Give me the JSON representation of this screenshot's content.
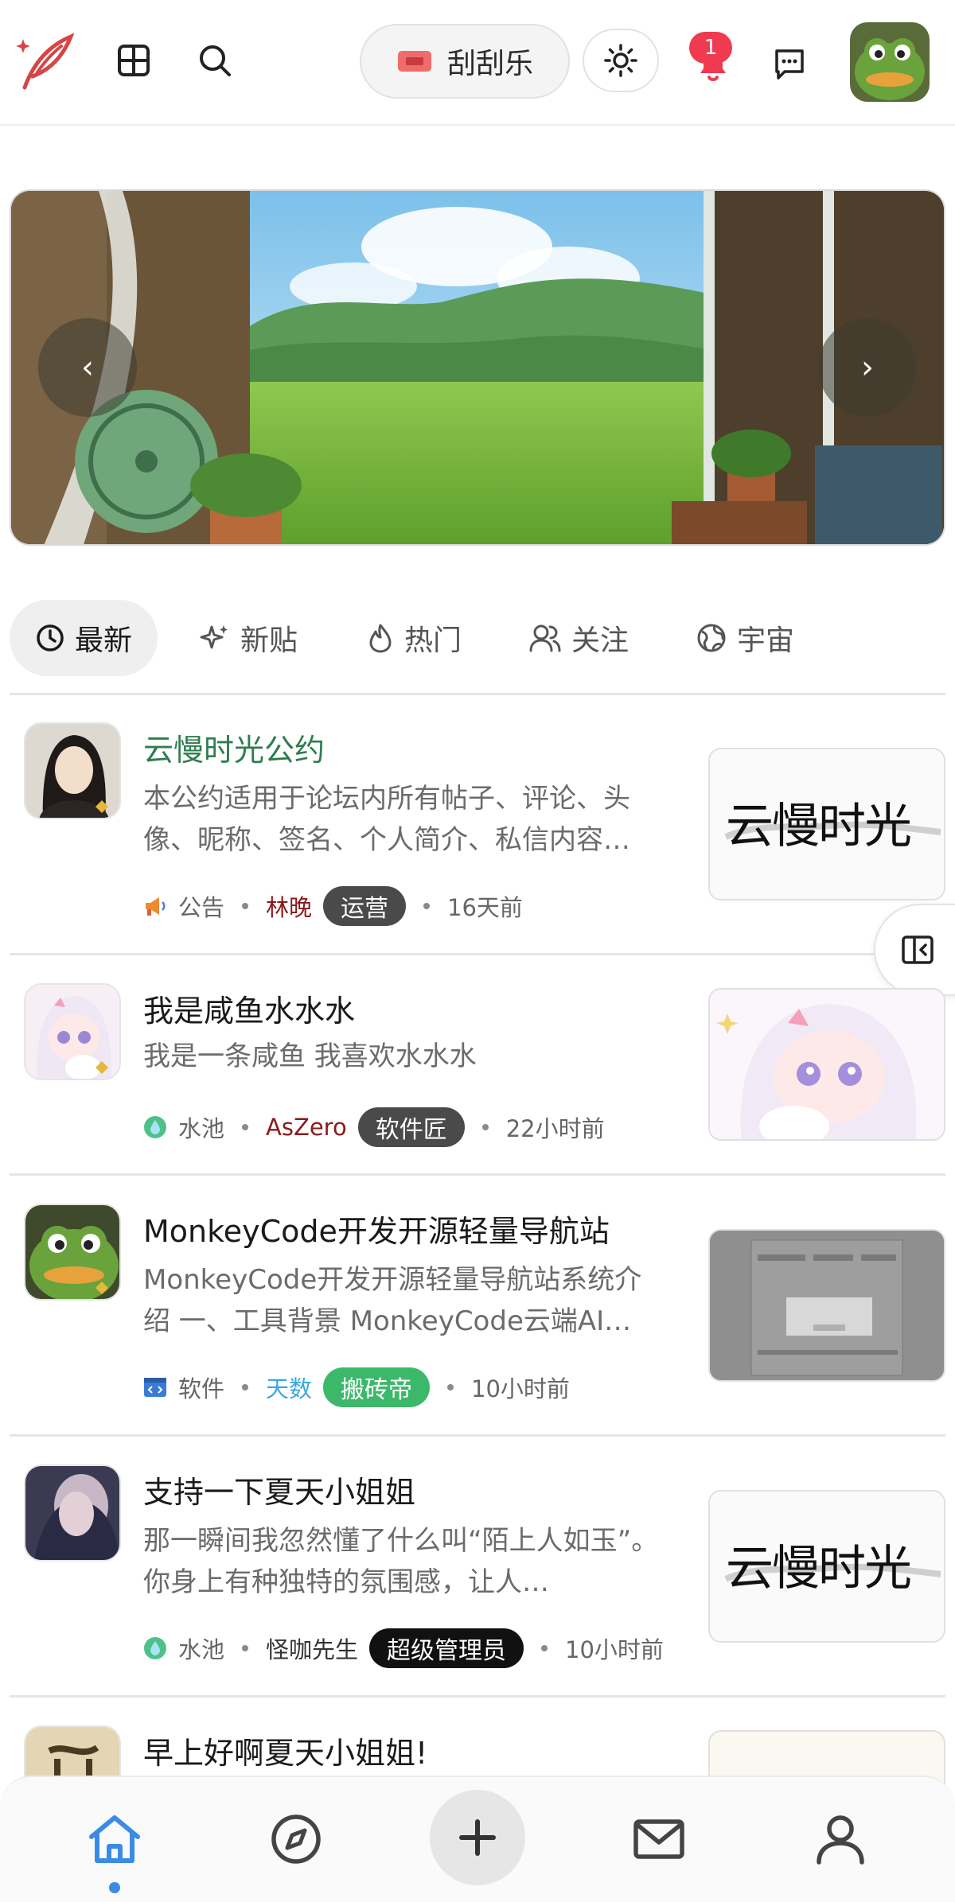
{
  "header": {
    "lottery_label": "刮刮乐",
    "notification_count": "1"
  },
  "tabs": [
    {
      "label": "最新",
      "icon": "clock-icon",
      "active": true
    },
    {
      "label": "新贴",
      "icon": "sparkle-icon",
      "active": false
    },
    {
      "label": "热门",
      "icon": "flame-icon",
      "active": false
    },
    {
      "label": "关注",
      "icon": "users-icon",
      "active": false
    },
    {
      "label": "宇宙",
      "icon": "globe-icon",
      "active": false
    }
  ],
  "posts": [
    {
      "title": "云慢时光公约",
      "excerpt": "本公约适用于论坛内所有帖子、评论、头像、昵称、签名、个人简介、私信内容…",
      "category": "公告",
      "category_icon": "megaphone-icon",
      "author": "林晚",
      "author_color": "#8b1a1a",
      "role": "运营",
      "role_color": "#4a4a4a",
      "time": "16天前",
      "thumb_text": "云慢时光",
      "pinned": true
    },
    {
      "title": "我是咸鱼水水水",
      "excerpt": "我是一条咸鱼 我喜欢水水水",
      "category": "水池",
      "category_icon": "water-icon",
      "author": "AsZero",
      "author_color": "#8b1a1a",
      "role": "软件匠",
      "role_color": "#4a4a4a",
      "time": "22小时前",
      "pinned": false
    },
    {
      "title": "MonkeyCode开发开源轻量导航站",
      "excerpt": "MonkeyCode开发开源轻量导航站系统介绍 一、工具背景 MonkeyCode云端AI…",
      "category": "软件",
      "category_icon": "code-icon",
      "author": "天数",
      "author_color": "#3aa8e0",
      "role": "搬砖帝",
      "role_color": "#3cb86a",
      "time": "10小时前",
      "pinned": false
    },
    {
      "title": "支持一下夏天小姐姐",
      "excerpt": "那一瞬间我忽然懂了什么叫“陌上人如玉”。你身上有种独特的氛围感，让人…",
      "category": "水池",
      "category_icon": "water-icon",
      "author": "怪咖先生",
      "author_color": "#333333",
      "role": "超级管理员",
      "role_color": "#111111",
      "time": "10小时前",
      "thumb_text": "云慢时光",
      "pinned": false
    },
    {
      "title": "早上好啊夏天小姐姐!",
      "pinned": false
    }
  ],
  "colors": {
    "accent": "#3b8be6",
    "pinned_title": "#2f7d4f",
    "notification": "#ef3a4f",
    "logo": "#d64545"
  }
}
